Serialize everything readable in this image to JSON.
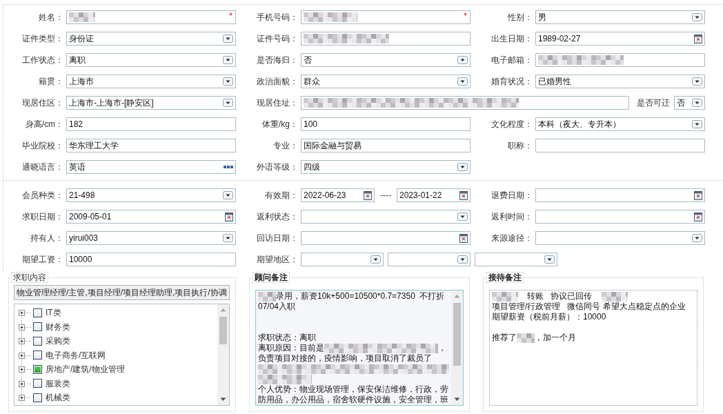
{
  "personal_info": {
    "rows": [
      [
        {
          "label": "姓名：",
          "controls": [
            {
              "kind": "text",
              "mask": {
                "kind": "short"
              },
              "required_mark": "*"
            }
          ]
        },
        {
          "label": "手机号码：",
          "controls": [
            {
              "kind": "text",
              "mask": {
                "kind": "medium"
              },
              "required_mark": "*"
            }
          ]
        },
        {
          "label": "性别：",
          "controls": [
            {
              "kind": "select",
              "value": "男"
            }
          ]
        }
      ],
      [
        {
          "label": "证件类型：",
          "controls": [
            {
              "kind": "select",
              "value": "身份证"
            }
          ]
        },
        {
          "label": "证件号码：",
          "controls": [
            {
              "kind": "text",
              "mask": {
                "kind": "long"
              }
            }
          ]
        },
        {
          "label": "出生日期：",
          "controls": [
            {
              "kind": "date",
              "value": "1989-02-27"
            }
          ]
        }
      ],
      [
        {
          "label": "工作状态：",
          "controls": [
            {
              "kind": "select",
              "value": "离职"
            }
          ]
        },
        {
          "label": "是否海归：",
          "controls": [
            {
              "kind": "select",
              "value": "否"
            }
          ]
        },
        {
          "label": "电子邮箱：",
          "controls": [
            {
              "kind": "text",
              "mask": {
                "kind": "long"
              }
            }
          ]
        }
      ],
      [
        {
          "label": "籍贯：",
          "controls": [
            {
              "kind": "select",
              "value": "上海市"
            }
          ]
        },
        {
          "label": "政治面貌：",
          "controls": [
            {
              "kind": "select",
              "value": "群众"
            }
          ]
        },
        {
          "label": "婚育状况：",
          "controls": [
            {
              "kind": "select",
              "value": "已婚男性"
            }
          ]
        }
      ],
      [
        {
          "label": "现居住区：",
          "controls": [
            {
              "kind": "select",
              "value": "上海市-上海市-[静安区]"
            }
          ]
        },
        {
          "label": "现居住址：",
          "controls": [
            {
              "kind": "text",
              "mask": {
                "kind": "xxlong"
              }
            },
            {
              "kind": "label",
              "text": "是否可迁"
            },
            {
              "kind": "select",
              "value": "否"
            }
          ]
        }
      ],
      [
        {
          "label": "身高/cm：",
          "controls": [
            {
              "kind": "text",
              "value": "182"
            }
          ]
        },
        {
          "label": "体重/kg：",
          "controls": [
            {
              "kind": "text",
              "value": "100"
            }
          ]
        },
        {
          "label": "文化程度：",
          "controls": [
            {
              "kind": "select",
              "value": "本科（夜大、专升本）"
            }
          ]
        }
      ],
      [
        {
          "label": "毕业院校：",
          "controls": [
            {
              "kind": "text",
              "value": "华东理工大学"
            }
          ]
        },
        {
          "label": "专业：",
          "controls": [
            {
              "kind": "text",
              "value": "国际金融与贸易"
            }
          ]
        },
        {
          "label": "职称：",
          "controls": [
            {
              "kind": "text"
            }
          ]
        }
      ],
      [
        {
          "label": "通晓语言：",
          "controls": [
            {
              "kind": "picker",
              "value": "英语"
            }
          ]
        },
        {
          "label": "外语等级：",
          "controls": [
            {
              "kind": "select",
              "value": "四级"
            }
          ]
        }
      ]
    ]
  },
  "membership_info": {
    "rows": [
      [
        {
          "label": "会员种类：",
          "controls": [
            {
              "kind": "select",
              "value": "21-498"
            }
          ]
        },
        {
          "label": "有效期：",
          "controls": [
            {
              "kind": "date",
              "value": "2022-06-23"
            },
            {
              "kind": "separator",
              "text": "----"
            },
            {
              "kind": "date",
              "value": "2023-01-22"
            }
          ]
        },
        {
          "label": "退费日期：",
          "controls": [
            {
              "kind": "date"
            }
          ]
        }
      ],
      [
        {
          "label": "求职日期：",
          "controls": [
            {
              "kind": "date",
              "value": "2009-05-01"
            }
          ]
        },
        {
          "label": "返利状态：",
          "controls": [
            {
              "kind": "select"
            }
          ]
        },
        {
          "label": "返利时间：",
          "controls": [
            {
              "kind": "date"
            }
          ]
        }
      ],
      [
        {
          "label": "持有人：",
          "controls": [
            {
              "kind": "select",
              "value": "yirui003"
            }
          ]
        },
        {
          "label": "回访日期：",
          "controls": [
            {
              "kind": "date"
            }
          ]
        },
        {
          "label": "来源途径：",
          "controls": [
            {
              "kind": "select"
            }
          ]
        }
      ],
      [
        {
          "label": "期望工资：",
          "controls": [
            {
              "kind": "text",
              "value": "10000"
            }
          ]
        },
        {
          "label": "期望地区：",
          "controls": [
            {
              "kind": "select"
            },
            {
              "kind": "select"
            },
            {
              "kind": "select"
            }
          ]
        }
      ]
    ]
  },
  "panels": [
    {
      "kind": "tree",
      "legend": "求职内容",
      "summary": "物业管理经理/主管,项目经理/项目经理助理,项目执行/协调",
      "scrollbar": true,
      "tree": [
        {
          "label": "IT类",
          "checked": false,
          "expanded": false
        },
        {
          "label": "财务类",
          "checked": false,
          "expanded": false
        },
        {
          "label": "采购类",
          "checked": false,
          "expanded": false
        },
        {
          "label": "电子商务/互联网",
          "checked": false,
          "expanded": false
        },
        {
          "label": "房地产/建筑/物业管理",
          "checked": true,
          "expanded": false
        },
        {
          "label": "服装类",
          "checked": false,
          "expanded": false
        },
        {
          "label": "机械类",
          "checked": false,
          "expanded": false
        }
      ]
    },
    {
      "kind": "notes",
      "legend": "顾问备注",
      "focused": true,
      "scrollbar": true,
      "lines": [
        {
          "kind": "text",
          "segments": [
            {
              "kind": "mask",
              "mask": {
                "kind": "tiny"
              }
            },
            {
              "kind": "text",
              "text": "录用，薪资10k+500=10500*0.7=7350  不打折"
            }
          ]
        },
        {
          "kind": "text",
          "segments": [
            {
              "kind": "text",
              "text": "07/04入职"
            }
          ]
        },
        {
          "kind": "blank"
        },
        {
          "kind": "blank"
        },
        {
          "kind": "text",
          "segments": [
            {
              "kind": "text",
              "text": "求职状态：离职"
            }
          ]
        },
        {
          "kind": "text",
          "segments": [
            {
              "kind": "text",
              "text": "离职原因：目前是"
            },
            {
              "kind": "mask",
              "mask": {
                "kind": "xlong"
              }
            },
            {
              "kind": "text",
              "text": "，"
            }
          ]
        },
        {
          "kind": "text",
          "segments": [
            {
              "kind": "text",
              "text": "负责项目对接的，疫情影响，项目取消了裁员了"
            }
          ]
        },
        {
          "kind": "text",
          "segments": [
            {
              "kind": "mask",
              "mask": {
                "kind": "line"
              }
            }
          ]
        },
        {
          "kind": "text",
          "segments": [
            {
              "kind": "mask",
              "mask": {
                "kind": "medium"
              }
            }
          ]
        },
        {
          "kind": "text",
          "segments": [
            {
              "kind": "text",
              "text": "个人优势：物业现场管理，保安保洁维修，行政，劳"
            }
          ]
        },
        {
          "kind": "text",
          "segments": [
            {
              "kind": "text",
              "text": "防用品，办公用品，宿舍软硬件设施，安全管理，班"
            }
          ]
        }
      ]
    },
    {
      "kind": "notes",
      "legend": "接待备注",
      "focused": false,
      "scrollbar": false,
      "lines": [
        {
          "kind": "text",
          "segments": [
            {
              "kind": "mask",
              "mask": {
                "kind": "short"
              }
            },
            {
              "kind": "text",
              "text": "    转账   协议已回传    "
            },
            {
              "kind": "mask",
              "mask": {
                "kind": "short"
              }
            }
          ]
        },
        {
          "kind": "text",
          "segments": [
            {
              "kind": "text",
              "text": "项目管理/行政管理   微信同号 希望大点稳定点的企业"
            }
          ]
        },
        {
          "kind": "text",
          "segments": [
            {
              "kind": "text",
              "text": "期望薪资（税前月薪）：10000"
            }
          ]
        },
        {
          "kind": "blank"
        },
        {
          "kind": "text",
          "segments": [
            {
              "kind": "text",
              "text": "推荐了"
            },
            {
              "kind": "mask",
              "mask": {
                "kind": "tiny"
              }
            },
            {
              "kind": "text",
              "text": "，加一个月"
            }
          ]
        }
      ]
    }
  ]
}
